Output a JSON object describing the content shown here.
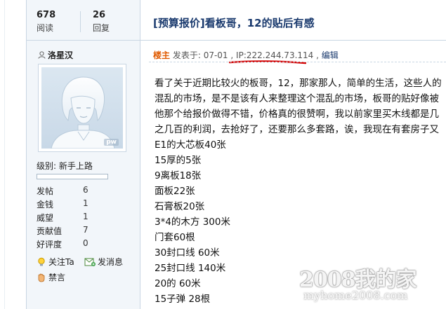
{
  "stats": {
    "views_count": "678",
    "views_label": "阅读",
    "replies_count": "26",
    "replies_label": "回复"
  },
  "thread": {
    "title": "[预算报价]看板哥，12的贴后有感"
  },
  "author": {
    "name": "洛星汉",
    "avatar_badge": "pw",
    "level": "级别: 新手上路",
    "level_progress": 0.0,
    "properties": [
      {
        "key": "发帖",
        "value": "6"
      },
      {
        "key": "金钱",
        "value": "1"
      },
      {
        "key": "威望",
        "value": "1"
      },
      {
        "key": "贡献值",
        "value": "7"
      },
      {
        "key": "好评度",
        "value": "0"
      }
    ],
    "actions": {
      "follow": "关注Ta",
      "message": "发消息",
      "ban": "禁言"
    }
  },
  "post": {
    "poster_tag": "楼主",
    "posted_at": "发表于: 07-01",
    "ip": "IP:222.244.73.114",
    "edit_label": "编辑",
    "lines": [
      "看了关于近期比较火的板哥，12，那家那人，简单的生活，这些人的",
      "混乱的市场，是不是该有人来整理这个混乱的市场，板哥的贴好像被",
      "他那个给报价做得不错，价格真的很赞啊，我以前家里买木线都是几",
      "之几百的利润，去抢好了，还要那么多套路，诶，我现在有套房子又",
      "E1的大芯板40张",
      "15厚的5张",
      "9离板18张",
      "面板22张",
      "石膏板20张",
      "3*4的木方  300米",
      "门套60根",
      "30封口线  60米",
      "25封口线  140米",
      "20的    60米",
      "15子弹  28根"
    ]
  },
  "watermark": {
    "main": "2008我的家",
    "sub": "myhome2008.com"
  },
  "colors": {
    "title": "#1a3a6e",
    "poster_tag": "#e05a00",
    "sidebar_bg": "#f2f6fa",
    "border": "#c9d6e3",
    "ip_underline": "#d40000"
  }
}
